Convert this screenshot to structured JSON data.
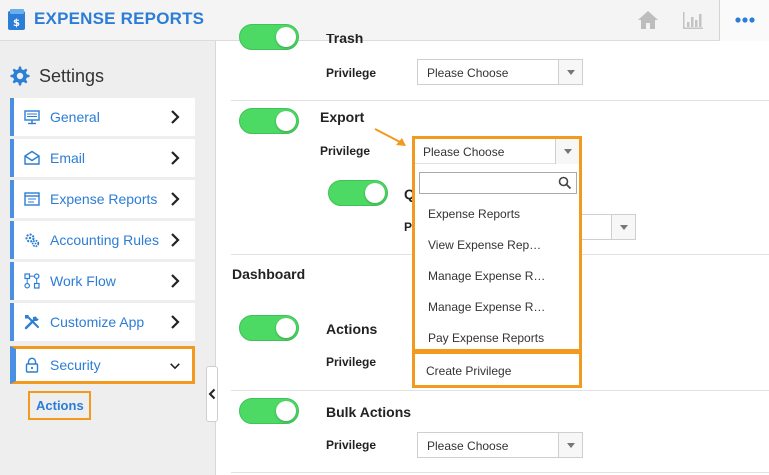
{
  "header": {
    "title": "EXPENSE REPORTS",
    "logo_icon": "wallet-dollar-icon",
    "home_icon": "home-icon",
    "chart_icon": "bar-chart-icon",
    "more_icon": "more-dots-icon",
    "accent_color": "#2c7dd6"
  },
  "sidebar": {
    "title": "Settings",
    "items": [
      {
        "label": "General",
        "icon": "monitor-icon"
      },
      {
        "label": "Email",
        "icon": "envelope-icon"
      },
      {
        "label": "Expense Reports",
        "icon": "window-list-icon"
      },
      {
        "label": "Accounting Rules",
        "icon": "gear-settings-icon"
      },
      {
        "label": "Work Flow",
        "icon": "workflow-icon"
      },
      {
        "label": "Customize App",
        "icon": "tools-icon"
      },
      {
        "label": "Security",
        "icon": "lock-icon",
        "expanded": true
      }
    ],
    "sub_item": "Actions",
    "highlight_color": "#f29a1d"
  },
  "main": {
    "trash": {
      "title": "Trash",
      "privilege_label": "Privilege",
      "privilege_value": "Please Choose",
      "enabled": true
    },
    "export": {
      "title": "Export",
      "privilege_label": "Privilege",
      "privilege_value": "Please Choose",
      "enabled": true
    },
    "export_sub": {
      "title_partial": "Q",
      "privilege_partial": "P",
      "enabled": true
    },
    "dashboard_section": "Dashboard",
    "actions": {
      "title": "Actions",
      "privilege_label": "Privilege",
      "enabled": true
    },
    "bulk_actions": {
      "title": "Bulk Actions",
      "privilege_label": "Privilege",
      "privilege_value": "Please Choose",
      "enabled": true
    }
  },
  "dropdown": {
    "selected": "Please Choose",
    "search_placeholder": "",
    "options": [
      "Expense Reports",
      "View Expense Rep…",
      "Manage Expense R…",
      "Manage Expense R…",
      "Pay Expense Reports"
    ],
    "create_label": "Create Privilege"
  }
}
